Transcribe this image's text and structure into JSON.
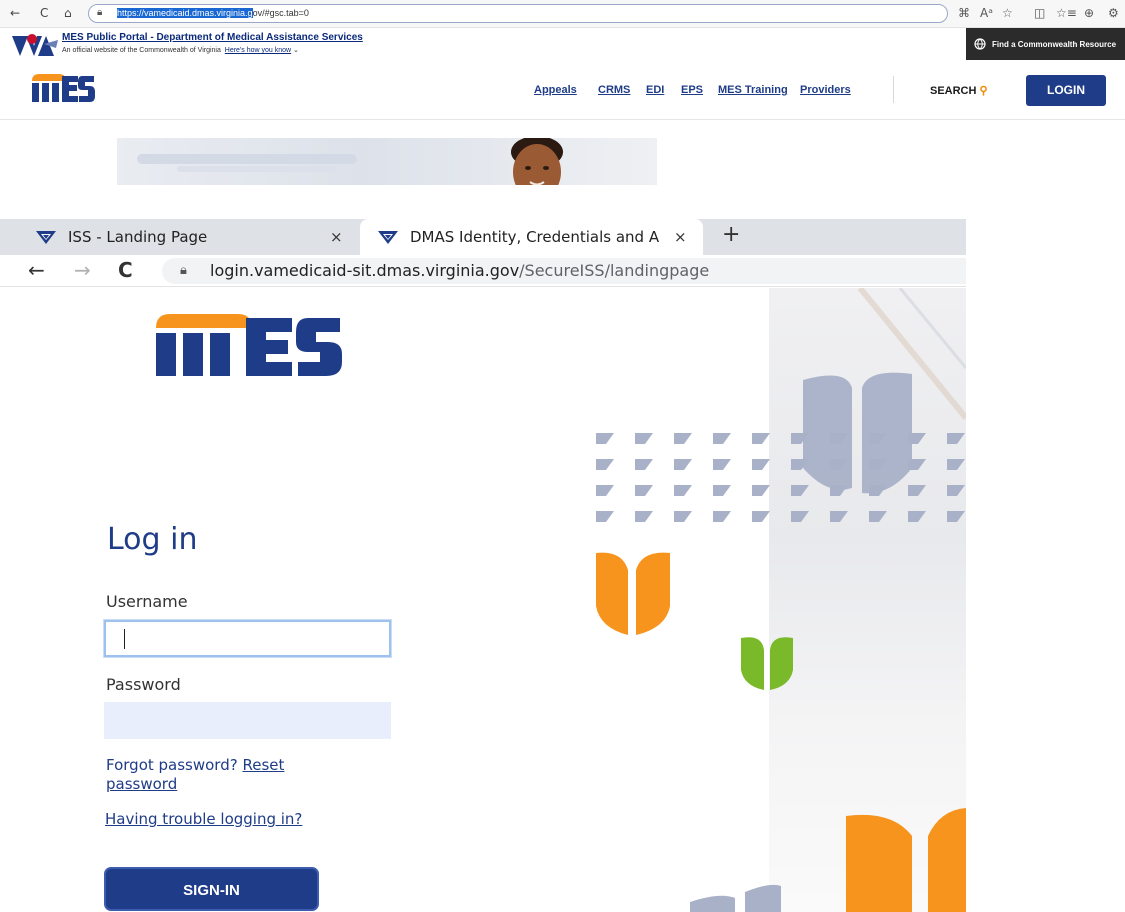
{
  "browser1": {
    "url_selected": "https://vamedicaid.dmas.virginia.g",
    "url_rest": "ov/#gsc.tab=0",
    "nav": {
      "back": "←",
      "refresh": "C",
      "home": "⌂"
    },
    "right_icons": [
      "⌘",
      "Aᵃ",
      "☆",
      "◫",
      "☆≡",
      "⊕",
      "⚙"
    ]
  },
  "gov_banner": {
    "title": "MES Public Portal - Department of Medical Assistance Services",
    "subtitle": "An official website of the Commonwealth of Virginia",
    "how_you_know": "Here's how you know",
    "resource_button": "Find a Commonwealth Resource"
  },
  "mes_header": {
    "nav": [
      "Appeals",
      "CRMS",
      "EDI",
      "EPS",
      "MES Training",
      "Providers"
    ],
    "search": "SEARCH",
    "login": "LOGIN"
  },
  "browser2": {
    "tabs": [
      {
        "label": "ISS - Landing Page",
        "close": "×"
      },
      {
        "label": "DMAS Identity, Credentials and A",
        "close": "×"
      }
    ],
    "new_tab": "+",
    "nav": {
      "back": "←",
      "forward": "→",
      "refresh": "C"
    },
    "url_host": "login.vamedicaid-sit.dmas.virginia.gov",
    "url_path": "/SecureISS/landingpage"
  },
  "login": {
    "title": "Log in",
    "username_label": "Username",
    "username_value": "",
    "password_label": "Password",
    "password_value": "",
    "forgot_text": "Forgot password?",
    "reset_link": "Reset password",
    "trouble_link": "Having trouble logging in?",
    "signin": "SIGN-IN"
  },
  "colors": {
    "brand_blue": "#1f3c88",
    "brand_orange": "#f7941d",
    "brand_green": "#7ab929",
    "deco_slate": "#a9b1c8"
  },
  "icons": [
    "lock-icon",
    "search-icon",
    "globe-icon",
    "chevron-down-icon",
    "va-logo-icon",
    "close-icon",
    "plus-icon"
  ]
}
